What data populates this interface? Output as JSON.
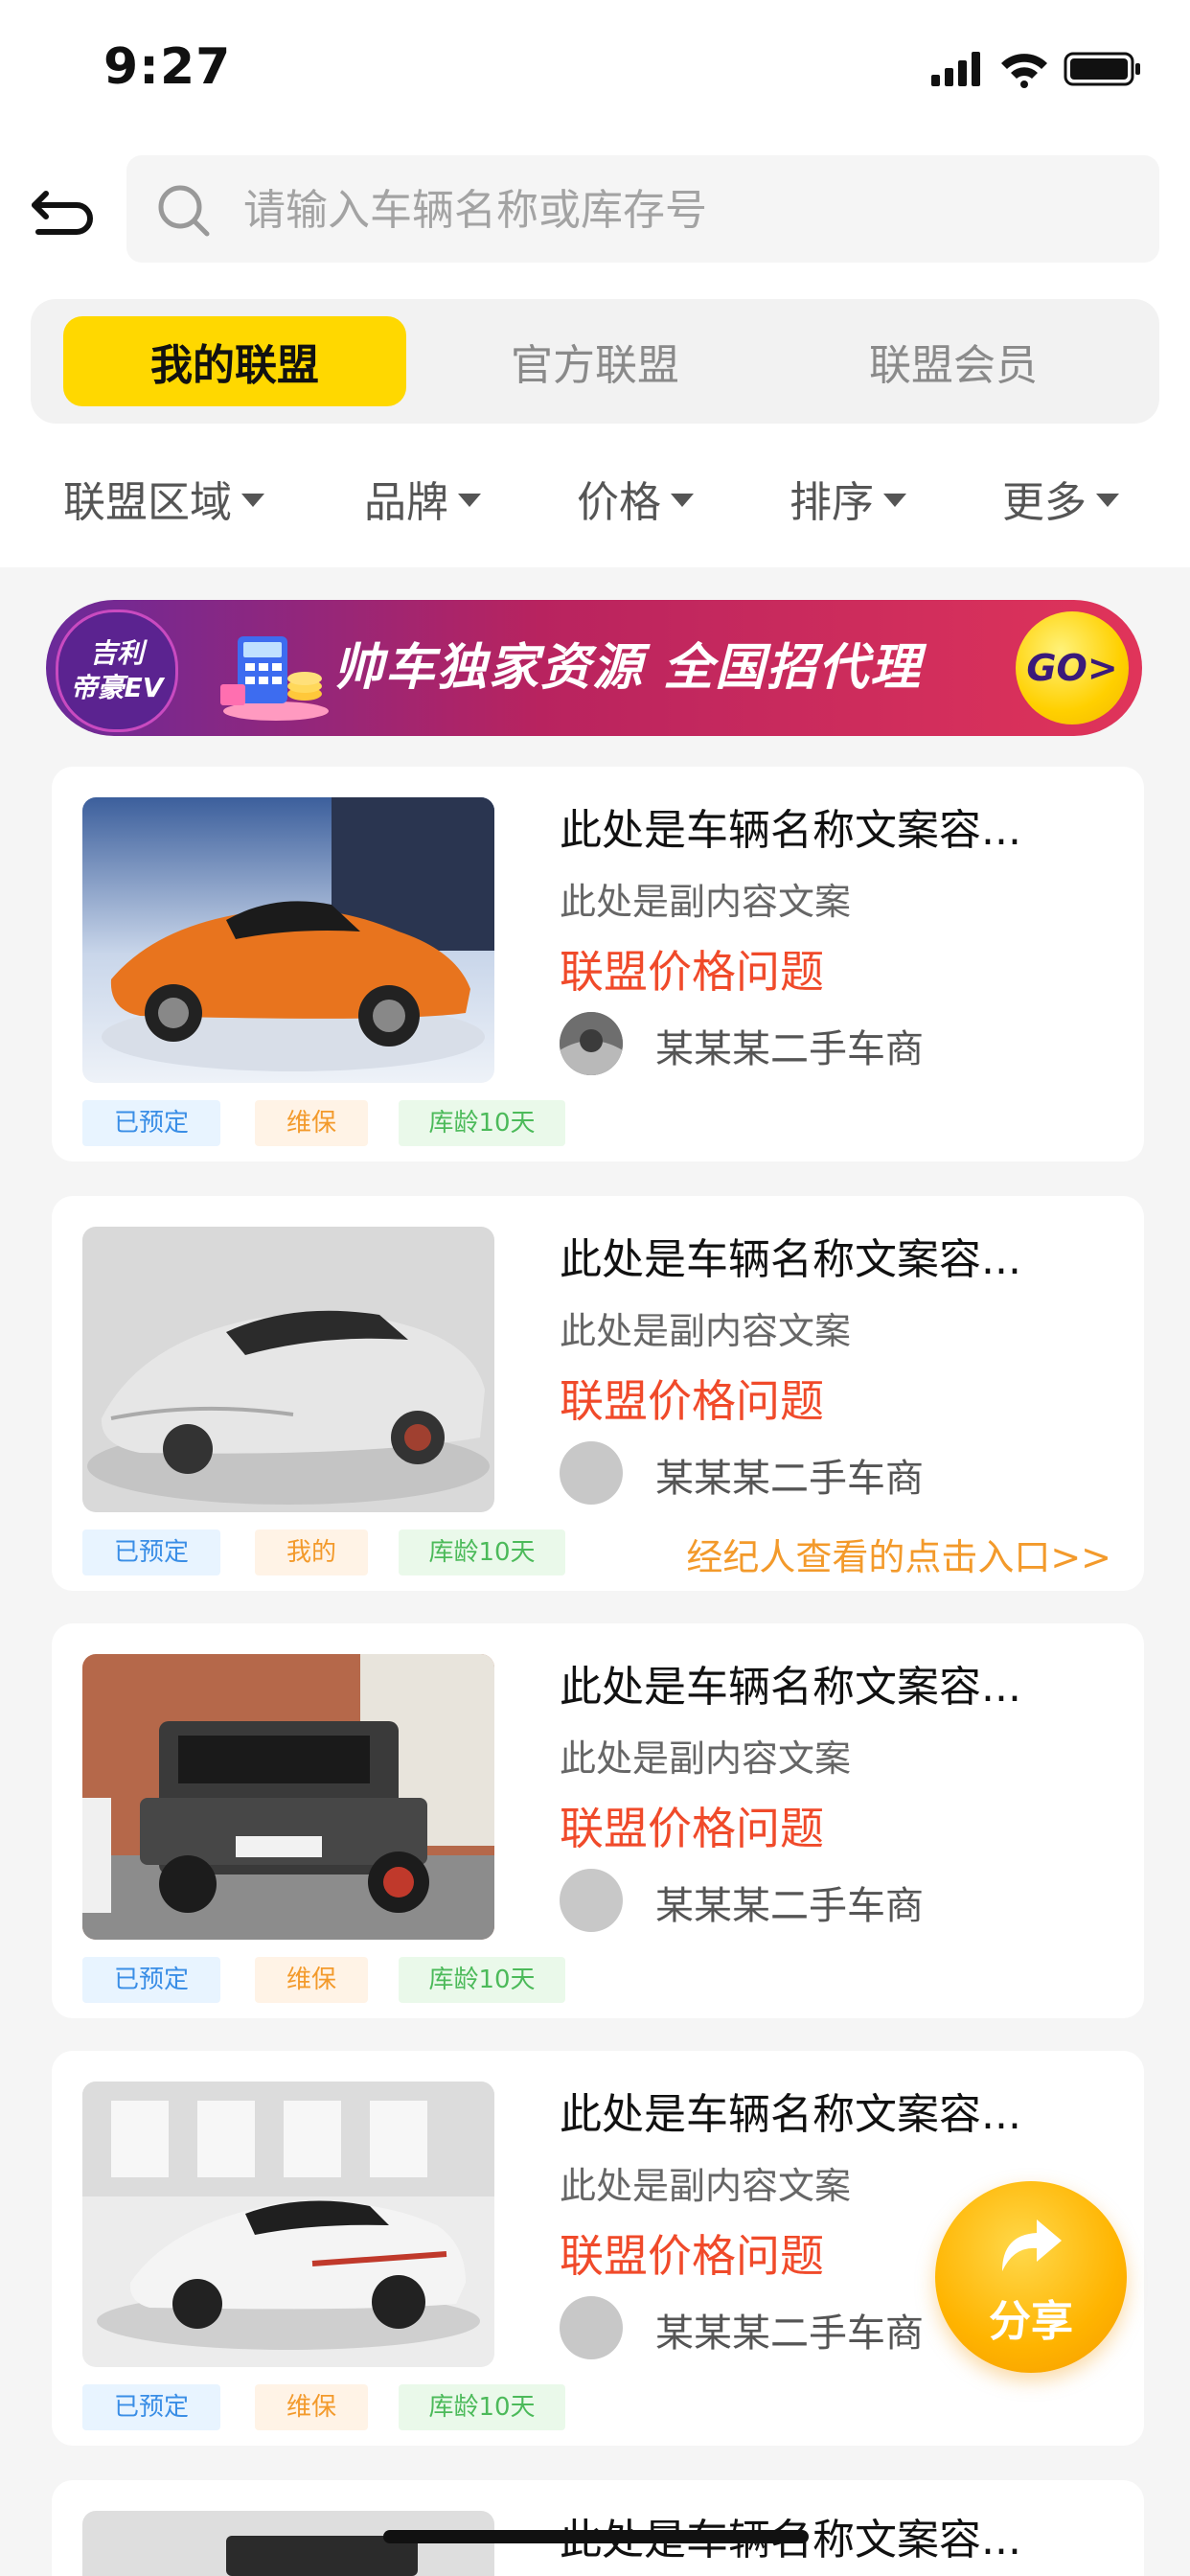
{
  "status_bar": {
    "time": "9:27"
  },
  "search": {
    "placeholder": "请输入车辆名称或库存号"
  },
  "tabs": [
    {
      "label": "我的联盟",
      "active": true
    },
    {
      "label": "官方联盟",
      "active": false
    },
    {
      "label": "联盟会员",
      "active": false
    }
  ],
  "filters": [
    "联盟区域",
    "品牌",
    "价格",
    "排序",
    "更多"
  ],
  "banner": {
    "badge_line1": "吉利",
    "badge_line2": "帝豪EV",
    "title": "帅车独家资源  全国招代理",
    "go": "GO>"
  },
  "listings": [
    {
      "name": "此处是车辆名称文案容...",
      "subtitle": "此处是副内容文案",
      "price": "联盟价格问题",
      "seller": "某某某二手车商",
      "tags": [
        "已预定",
        "维保",
        "库龄10天"
      ],
      "link": ""
    },
    {
      "name": "此处是车辆名称文案容...",
      "subtitle": "此处是副内容文案",
      "price": "联盟价格问题",
      "seller": "某某某二手车商",
      "tags": [
        "已预定",
        "我的",
        "库龄10天"
      ],
      "link": "经纪人查看的点击入口>>"
    },
    {
      "name": "此处是车辆名称文案容...",
      "subtitle": "此处是副内容文案",
      "price": "联盟价格问题",
      "seller": "某某某二手车商",
      "tags": [
        "已预定",
        "维保",
        "库龄10天"
      ],
      "link": ""
    },
    {
      "name": "此处是车辆名称文案容...",
      "subtitle": "此处是副内容文案",
      "price": "联盟价格问题",
      "seller": "某某某二手车商",
      "tags": [
        "已预定",
        "维保",
        "库龄10天"
      ],
      "link": ""
    },
    {
      "name": "此处是车辆名称文案容..."
    }
  ],
  "share": {
    "label": "分享"
  },
  "colors": {
    "accent": "#ffd800",
    "price": "#f04a2a",
    "link": "#f39a2b"
  }
}
